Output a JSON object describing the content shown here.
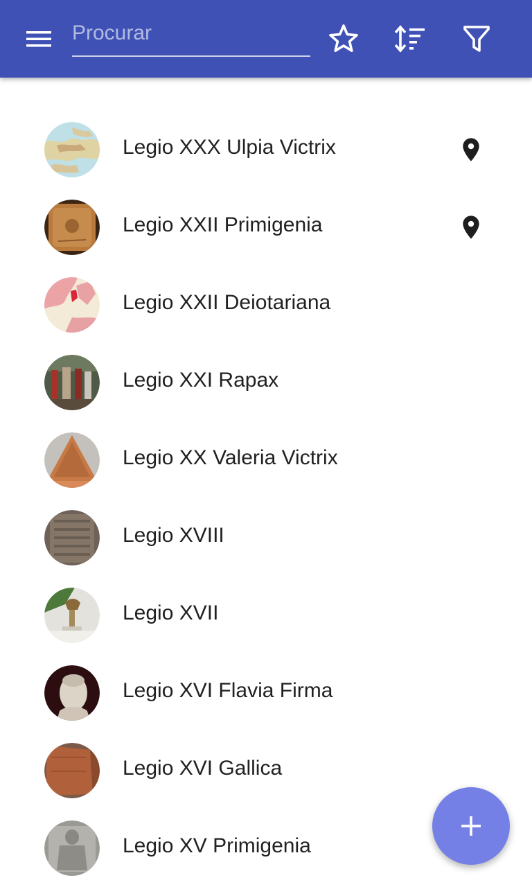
{
  "toolbar": {
    "search": {
      "placeholder": "Procurar",
      "value": ""
    },
    "icons": [
      "menu-icon",
      "star-outline-icon",
      "sort-icon",
      "filter-icon"
    ]
  },
  "legions": [
    {
      "name": "Legio XXX Ulpia Victrix",
      "located": true
    },
    {
      "name": "Legio XXII Primigenia",
      "located": true
    },
    {
      "name": "Legio XXII Deiotariana",
      "located": false
    },
    {
      "name": "Legio XXI Rapax",
      "located": false
    },
    {
      "name": "Legio XX Valeria Victrix",
      "located": false
    },
    {
      "name": "Legio XVIII",
      "located": false
    },
    {
      "name": "Legio XVII",
      "located": false
    },
    {
      "name": "Legio XVI Flavia Firma",
      "located": false
    },
    {
      "name": "Legio XVI Gallica",
      "located": false
    },
    {
      "name": "Legio XV Primigenia",
      "located": false
    }
  ],
  "fab": {
    "icon": "plus-icon"
  },
  "colors": {
    "appbar": "#3f51b5",
    "fab": "#7480e6",
    "text": "#212121",
    "pin": "#1e1e1e"
  }
}
